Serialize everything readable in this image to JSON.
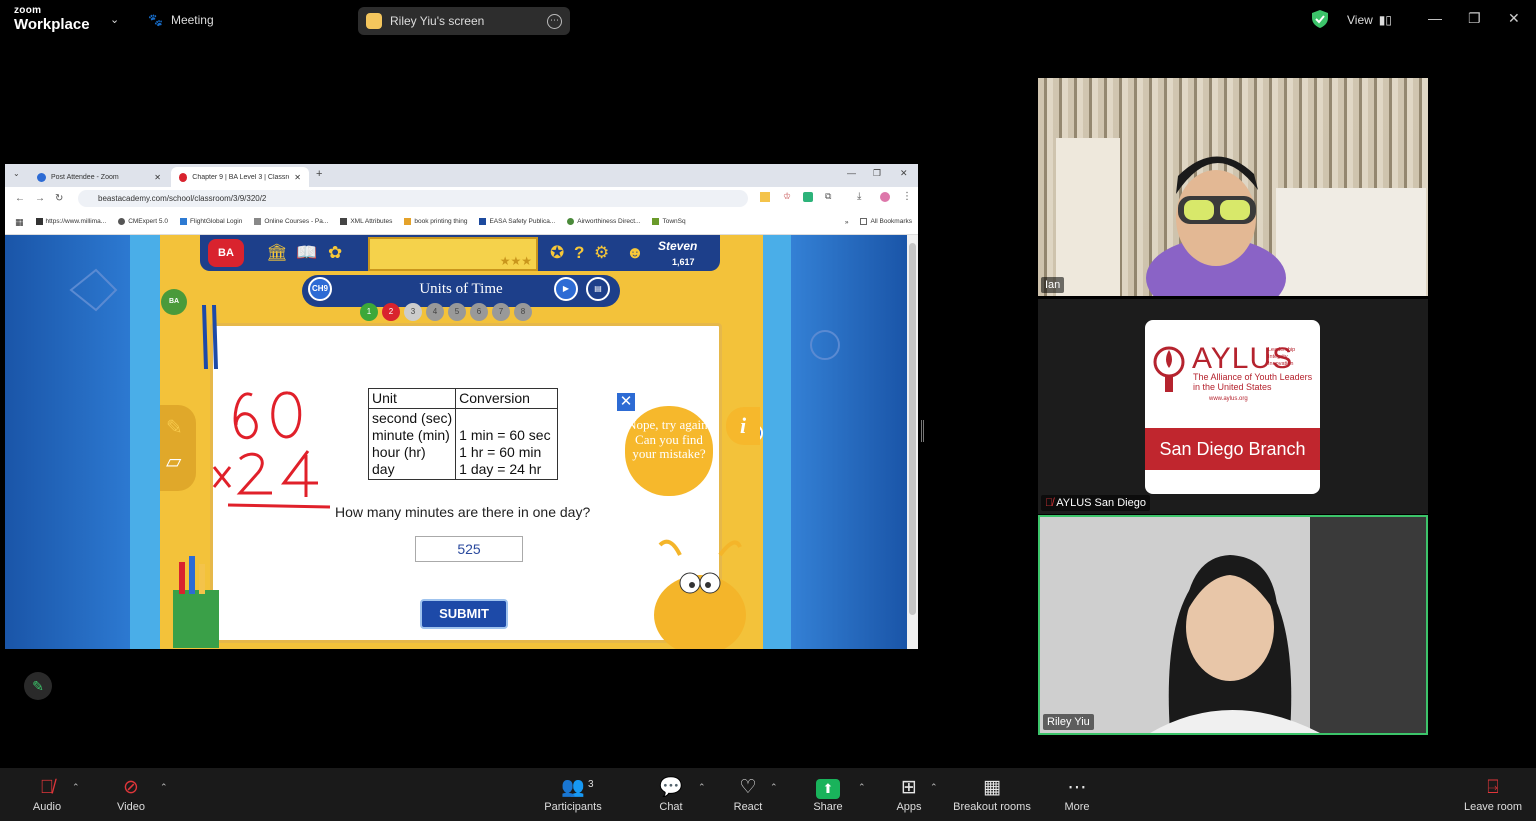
{
  "topbar": {
    "logo_small": "zoom",
    "logo_big": "Workplace",
    "meeting_label": "Meeting",
    "share_label": "Riley Yiu's screen",
    "view_label": "View"
  },
  "browser": {
    "tabs": [
      {
        "label": "Post Attendee - Zoom"
      },
      {
        "label": "Chapter 9 | BA Level 3 | Classro..."
      }
    ],
    "url": "beastacademy.com/school/classroom/3/9/320/2",
    "bookmarks": [
      "https://www.millima...",
      "CMExpert 5.0",
      "FlightGlobal Login",
      "Online Courses - Pa...",
      "XML Attributes",
      "book printing thing",
      "EASA Safety Publica...",
      "Airworthiness Direct...",
      "TownSq",
      "All Bookmarks"
    ]
  },
  "game": {
    "logo": "BA",
    "user": "Steven",
    "coins": "1,617",
    "chapter_badge": "CH9",
    "title": "Units of Time",
    "progress_dots": [
      "1",
      "2",
      "3",
      "4",
      "5",
      "6",
      "7",
      "8"
    ],
    "table": {
      "headers": [
        "Unit",
        "Conversion"
      ],
      "units": [
        "second (sec)",
        "minute (min)",
        "hour (hr)",
        "day"
      ],
      "conversions": [
        "",
        "1 min = 60 sec",
        "1 hr = 60 min",
        "1 day = 24 hr"
      ]
    },
    "question": "How many minutes are there in one day?",
    "answer": "525",
    "submit": "SUBMIT",
    "feedback": "Nope, try again. Can you find your mistake?",
    "info": "i",
    "close": "✕"
  },
  "participants": [
    {
      "name": "Ian"
    },
    {
      "name": "AYLUS San Diego",
      "muted": true
    },
    {
      "name": "Riley Yiu"
    }
  ],
  "aylus": {
    "title": "AYLUS",
    "tagline": "Leadership Integrity Innovation",
    "subtitle": "The Alliance of Youth Leaders in the United States",
    "url": "www.aylus.org",
    "branch": "San Diego Branch"
  },
  "toolbar": {
    "audio": "Audio",
    "video": "Video",
    "participants": "Participants",
    "participants_count": "3",
    "chat": "Chat",
    "react": "React",
    "share": "Share",
    "apps": "Apps",
    "breakout": "Breakout rooms",
    "more": "More",
    "leave": "Leave room"
  },
  "colors": {
    "accent_green": "#3cc46a",
    "share_green": "#19b35b",
    "muted_red": "#e0363a",
    "aylus_red": "#c0262e",
    "game_yellow": "#f3c23a",
    "game_blue": "#1d3f8a"
  }
}
